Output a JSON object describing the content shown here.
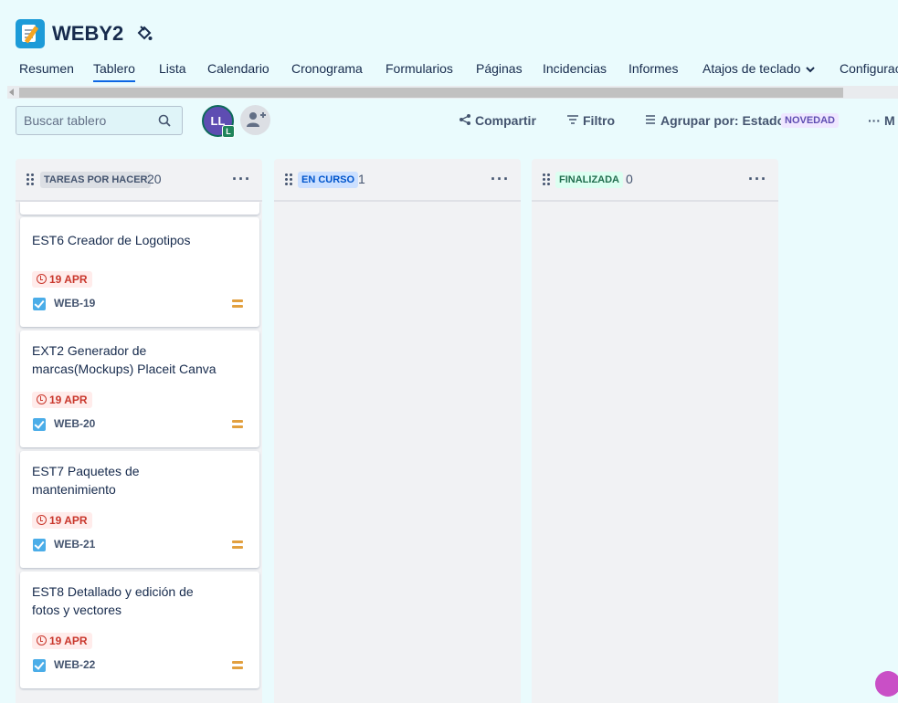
{
  "project": {
    "name": "WEBY2"
  },
  "tabs": [
    {
      "label": "Resumen"
    },
    {
      "label": "Tablero",
      "active": true
    },
    {
      "label": "Lista"
    },
    {
      "label": "Calendario"
    },
    {
      "label": "Cronograma"
    },
    {
      "label": "Formularios"
    },
    {
      "label": "Páginas"
    },
    {
      "label": "Incidencias"
    },
    {
      "label": "Informes"
    },
    {
      "label": "Atajos de teclado"
    },
    {
      "label": "Configurac"
    }
  ],
  "toolbar": {
    "search_placeholder": "Buscar tablero",
    "avatar_initials": "LL",
    "avatar_sub": "L",
    "share_label": "Compartir",
    "filter_label": "Filtro",
    "group_label": "Agrupar por: Estado",
    "new_badge": "NOVEDAD",
    "more_label": "M"
  },
  "columns": [
    {
      "label": "TAREAS POR HACER",
      "count": "20",
      "label_bg": "#dcdfe4",
      "label_color": "#44546f"
    },
    {
      "label": "EN CURSO",
      "count": "1",
      "label_bg": "#cce0ff",
      "label_color": "#0055cc"
    },
    {
      "label": "FINALIZADA",
      "count": "0",
      "label_bg": "#dcfff1",
      "label_color": "#216e4e"
    }
  ],
  "cards": [
    {
      "title": "EST6 Creador de Logotipos",
      "due": "19 APR",
      "key": "WEB-19"
    },
    {
      "title": "EXT2 Generador de marcas(Mockups) Placeit Canva",
      "due": "19 APR",
      "key": "WEB-20"
    },
    {
      "title": "EST7 Paquetes de mantenimiento",
      "due": "19 APR",
      "key": "WEB-21"
    },
    {
      "title": "EST8 Detallado y edición de fotos y vectores",
      "due": "19 APR",
      "key": "WEB-22"
    }
  ]
}
